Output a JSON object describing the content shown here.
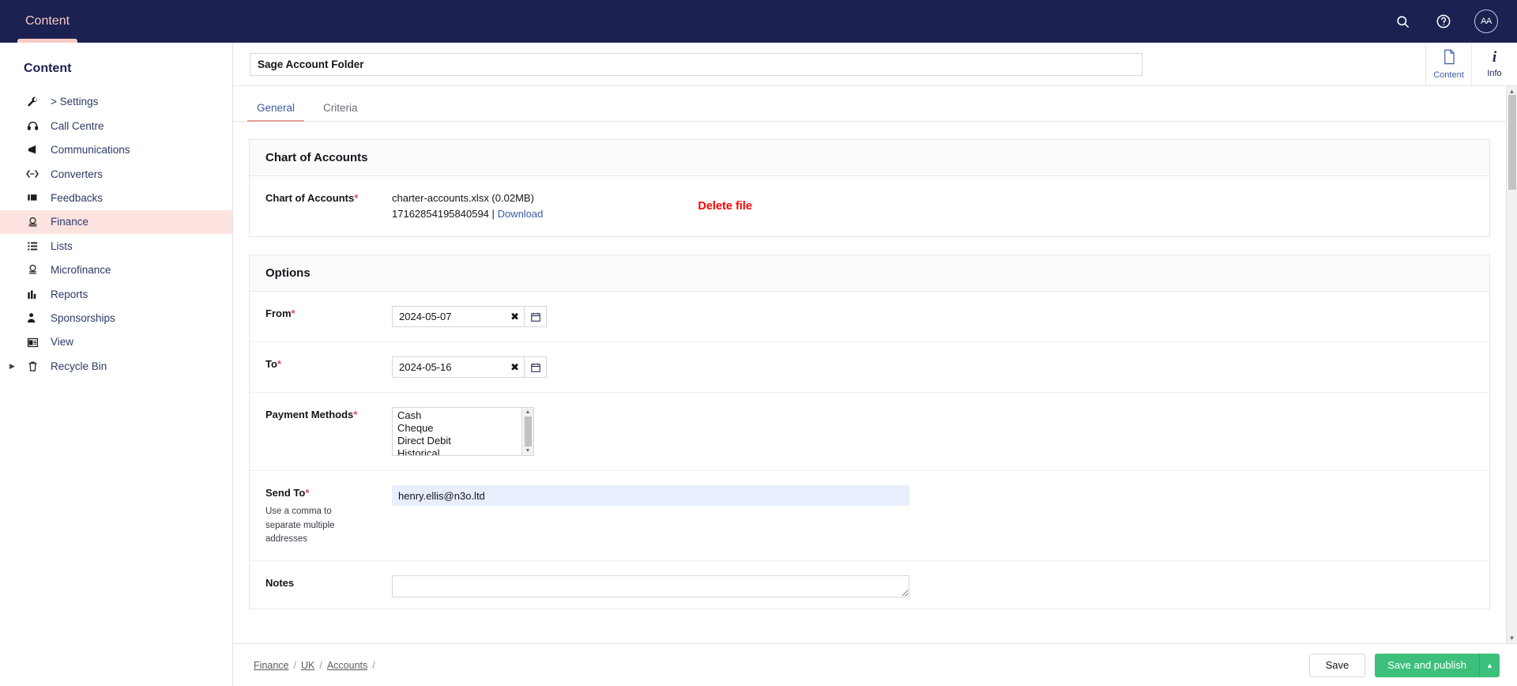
{
  "topbar": {
    "tab_label": "Content",
    "search_icon": "search-icon",
    "help_icon": "help-icon",
    "avatar_initials": "AA"
  },
  "sidebar": {
    "title": "Content",
    "items": [
      {
        "label": "> Settings",
        "icon": "wrench-icon",
        "active": false,
        "caret": false
      },
      {
        "label": "Call Centre",
        "icon": "headset-icon",
        "active": false,
        "caret": false
      },
      {
        "label": "Communications",
        "icon": "megaphone-icon",
        "active": false,
        "caret": false
      },
      {
        "label": "Converters",
        "icon": "code-arrows-icon",
        "active": false,
        "caret": false
      },
      {
        "label": "Feedbacks",
        "icon": "feedback-icon",
        "active": false,
        "caret": false
      },
      {
        "label": "Finance",
        "icon": "coins-icon",
        "active": true,
        "caret": false
      },
      {
        "label": "Lists",
        "icon": "list-icon",
        "active": false,
        "caret": false
      },
      {
        "label": "Microfinance",
        "icon": "coin-icon",
        "active": false,
        "caret": false
      },
      {
        "label": "Reports",
        "icon": "bar-chart-icon",
        "active": false,
        "caret": false
      },
      {
        "label": "Sponsorships",
        "icon": "person-star-icon",
        "active": false,
        "caret": false
      },
      {
        "label": "View",
        "icon": "window-icon",
        "active": false,
        "caret": false
      },
      {
        "label": "Recycle Bin",
        "icon": "trash-icon",
        "active": false,
        "caret": true
      }
    ]
  },
  "header": {
    "title_value": "Sage Account Folder",
    "title_placeholder": "Enter a name...",
    "actions": [
      {
        "label": "Content",
        "icon": "document-icon"
      },
      {
        "label": "Info",
        "icon": "info-italic-icon"
      }
    ]
  },
  "tabs": [
    {
      "label": "General",
      "active": true
    },
    {
      "label": "Criteria",
      "active": false
    }
  ],
  "chart_of_accounts": {
    "panel_title": "Chart of Accounts",
    "field_label": "Chart of Accounts",
    "required": "*",
    "file_name_size": "charter-accounts.xlsx (0.02MB)",
    "file_id": "17162854195840594",
    "separator": "|",
    "download_label": "Download",
    "delete_label": "Delete file",
    "delete_color": "#fe0000"
  },
  "options": {
    "panel_title": "Options",
    "from": {
      "label": "From",
      "required": "*",
      "value": "2024-05-07",
      "clear_glyph": "✖",
      "calendar_icon": "calendar-icon"
    },
    "to": {
      "label": "To",
      "required": "*",
      "value": "2024-05-16",
      "clear_glyph": "✖",
      "calendar_icon": "calendar-icon"
    },
    "payment_methods": {
      "label": "Payment Methods",
      "required": "*",
      "options": [
        "Cash",
        "Cheque",
        "Direct Debit",
        "Historical"
      ]
    },
    "send_to": {
      "label": "Send To",
      "required": "*",
      "hint": "Use a comma to separate multiple addresses",
      "value": "henry.ellis@n3o.ltd",
      "placeholder": ""
    },
    "notes": {
      "label": "Notes",
      "required": "",
      "value": "",
      "placeholder": ""
    }
  },
  "footer": {
    "breadcrumb": [
      "Finance",
      "UK",
      "Accounts"
    ],
    "separator": "/",
    "save_label": "Save",
    "publish_label": "Save and publish",
    "publish_color": "#3dc07c"
  }
}
